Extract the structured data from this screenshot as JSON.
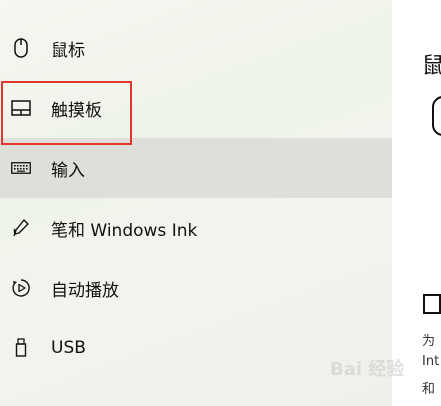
{
  "sidebar": {
    "items": [
      {
        "label": "鼠标",
        "icon": "mouse-icon"
      },
      {
        "label": "触摸板",
        "icon": "touchpad-icon"
      },
      {
        "label": "输入",
        "icon": "keyboard-icon"
      },
      {
        "label": "笔和 Windows Ink",
        "icon": "pen-icon"
      },
      {
        "label": "自动播放",
        "icon": "autoplay-icon"
      },
      {
        "label": "USB",
        "icon": "usb-icon"
      }
    ]
  },
  "content": {
    "title": "鼠",
    "lines": [
      "为",
      "Int",
      "和"
    ]
  },
  "watermark": "Bai 经验",
  "colors": {
    "highlight": "#e5362e",
    "hover": "#dedfd9"
  }
}
